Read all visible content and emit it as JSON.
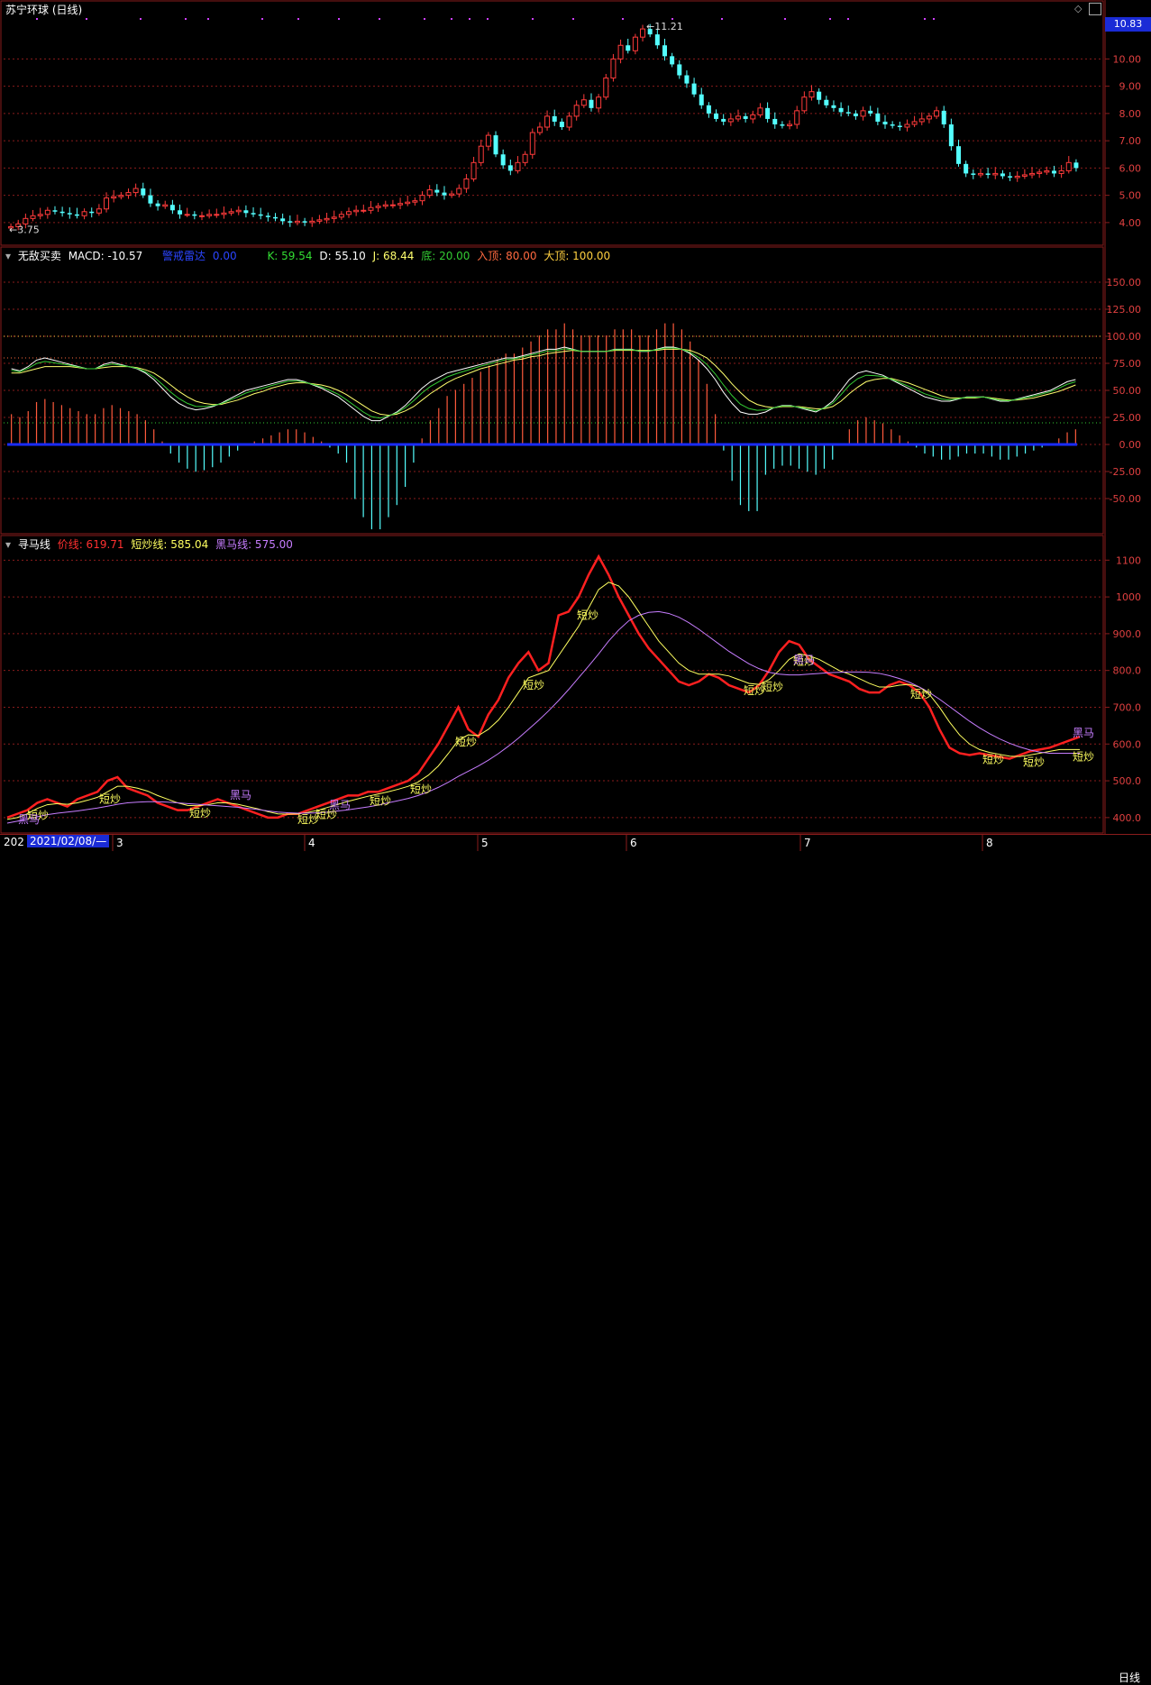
{
  "top_panel": {
    "title": "苏宁环球 (日线)",
    "high_label": "11.21",
    "low_label": "3.75",
    "current_price": "10.83",
    "y_ticks": [
      "10.00",
      "9.00",
      "8.00",
      "7.00",
      "6.00",
      "5.00",
      "4.00"
    ]
  },
  "mid_panel": {
    "indicator_name": "无敌买卖",
    "macd_label": "MACD: -10.57",
    "radar_label": "警戒雷达",
    "radar_value": "0.00",
    "k_label": "K: 59.54",
    "d_label": "D: 55.10",
    "j_label": "J: 68.44",
    "bottom_label": "底: 20.00",
    "entry_top_label": "入顶: 80.00",
    "big_top_label": "大顶: 100.00",
    "y_ticks": [
      "150.00",
      "125.00",
      "100.00",
      "75.00",
      "50.00",
      "25.00",
      "0.00",
      "-25.00",
      "-50.00"
    ]
  },
  "bottom_panel": {
    "indicator_name": "寻马线",
    "price_line_label": "价线: 619.71",
    "short_line_label": "短炒线: 585.04",
    "dark_horse_label": "黑马线: 575.00",
    "y_ticks": [
      "1100",
      "1000",
      "900.0",
      "800.0",
      "700.0",
      "600.0",
      "500.0",
      "400.0"
    ],
    "marker_short": "短炒",
    "marker_horse": "黑马"
  },
  "date_axis": {
    "start_stub": "202",
    "selected_date": "2021/02/08/—",
    "months": [
      "3",
      "4",
      "5",
      "6",
      "7",
      "8"
    ],
    "cycle": "日线"
  },
  "colors": {
    "up": "#ff3b3b",
    "down": "#54ffff",
    "macd_pos": "#ff5a3c",
    "macd_neg": "#54ffff",
    "k_line": "#ffffff",
    "d_line": "#ffff6e",
    "j_line": "#33cc33",
    "radar": "#1a2bff",
    "price_line": "#ff2020",
    "short_line": "#ffff60",
    "horse_line": "#c77dff",
    "grid": "#8a1c1c"
  },
  "chart_data": [
    {
      "type": "candlestick",
      "title": "苏宁环球 (日线)",
      "y_ticks": [
        4,
        5,
        6,
        7,
        8,
        9,
        10
      ],
      "ylim": [
        3.5,
        11.5
      ],
      "x_month_labels": [
        "3",
        "4",
        "5",
        "6",
        "7",
        "8"
      ],
      "annotated_high": 11.21,
      "annotated_low": 3.75,
      "last_price": 10.83,
      "closes": [
        3.85,
        3.95,
        4.15,
        4.25,
        4.3,
        4.45,
        4.4,
        4.35,
        4.3,
        4.25,
        4.4,
        4.35,
        4.5,
        4.9,
        4.95,
        5.0,
        5.1,
        5.25,
        5.0,
        4.7,
        4.6,
        4.65,
        4.45,
        4.3,
        4.3,
        4.25,
        4.25,
        4.3,
        4.3,
        4.35,
        4.4,
        4.45,
        4.35,
        4.3,
        4.25,
        4.2,
        4.15,
        4.05,
        4.0,
        4.05,
        4.0,
        4.05,
        4.1,
        4.15,
        4.2,
        4.3,
        4.4,
        4.45,
        4.45,
        4.55,
        4.6,
        4.65,
        4.65,
        4.7,
        4.75,
        4.8,
        5.0,
        5.2,
        5.1,
        5.0,
        5.05,
        5.25,
        5.6,
        6.2,
        6.8,
        7.2,
        6.5,
        6.1,
        5.9,
        6.2,
        6.5,
        7.3,
        7.5,
        7.9,
        7.7,
        7.5,
        7.9,
        8.3,
        8.5,
        8.2,
        8.6,
        9.3,
        10.0,
        10.5,
        10.3,
        10.8,
        11.1,
        10.9,
        10.5,
        10.1,
        9.8,
        9.4,
        9.1,
        8.7,
        8.3,
        8.0,
        7.8,
        7.7,
        7.8,
        7.9,
        7.8,
        7.95,
        8.2,
        7.8,
        7.6,
        7.55,
        7.6,
        8.1,
        8.6,
        8.8,
        8.5,
        8.3,
        8.2,
        8.05,
        8.0,
        7.9,
        8.1,
        8.0,
        7.7,
        7.6,
        7.55,
        7.5,
        7.6,
        7.7,
        7.8,
        7.9,
        8.1,
        7.6,
        6.8,
        6.15,
        5.8,
        5.75,
        5.8,
        5.75,
        5.8,
        5.7,
        5.65,
        5.7,
        5.75,
        5.8,
        5.85,
        5.9,
        5.8,
        5.9,
        6.2,
        6.0
      ]
    },
    {
      "type": "line",
      "title": "无敌买卖",
      "y_ticks": [
        -50,
        -25,
        0,
        25,
        50,
        75,
        100,
        125,
        150
      ],
      "ylim": [
        -75,
        175
      ],
      "reference_lines": {
        "bottom": 20.0,
        "entry_top": 80.0,
        "big_top": 100.0
      },
      "series": [
        {
          "name": "K",
          "last": 59.54
        },
        {
          "name": "D",
          "last": 55.1
        },
        {
          "name": "J",
          "last": 68.44
        },
        {
          "name": "MACD",
          "last": -10.57
        },
        {
          "name": "警戒雷达",
          "last": 0.0
        }
      ],
      "k_values": [
        70,
        68,
        72,
        78,
        80,
        78,
        76,
        74,
        72,
        70,
        70,
        74,
        76,
        74,
        72,
        70,
        66,
        60,
        52,
        44,
        38,
        34,
        32,
        33,
        35,
        38,
        42,
        46,
        50,
        52,
        54,
        56,
        58,
        60,
        60,
        58,
        55,
        52,
        48,
        44,
        38,
        32,
        26,
        22,
        22,
        26,
        30,
        36,
        44,
        52,
        58,
        62,
        66,
        68,
        70,
        72,
        74,
        76,
        78,
        80,
        80,
        82,
        84,
        86,
        88,
        88,
        90,
        88,
        86,
        86,
        86,
        86,
        88,
        88,
        88,
        86,
        86,
        88,
        90,
        90,
        88,
        84,
        78,
        70,
        60,
        48,
        38,
        30,
        28,
        28,
        30,
        34,
        36,
        36,
        34,
        32,
        30,
        34,
        40,
        50,
        60,
        66,
        68,
        66,
        64,
        60,
        56,
        52,
        48,
        44,
        42,
        40,
        40,
        42,
        44,
        44,
        44,
        42,
        40,
        40,
        42,
        44,
        46,
        48,
        50,
        54,
        58,
        60
      ],
      "d_values": [
        66,
        66,
        68,
        70,
        72,
        72,
        72,
        72,
        71,
        70,
        70,
        71,
        72,
        72,
        72,
        71,
        69,
        66,
        61,
        55,
        49,
        44,
        40,
        38,
        37,
        37,
        39,
        41,
        44,
        47,
        49,
        52,
        54,
        56,
        57,
        57,
        56,
        55,
        53,
        50,
        46,
        41,
        36,
        31,
        28,
        27,
        28,
        31,
        35,
        41,
        47,
        52,
        57,
        61,
        64,
        67,
        70,
        72,
        74,
        76,
        78,
        79,
        81,
        82,
        84,
        85,
        86,
        87,
        86,
        86,
        86,
        86,
        87,
        87,
        87,
        87,
        87,
        87,
        88,
        88,
        88,
        87,
        84,
        80,
        73,
        65,
        56,
        48,
        41,
        37,
        35,
        34,
        35,
        35,
        35,
        34,
        33,
        33,
        35,
        40,
        47,
        53,
        58,
        60,
        61,
        61,
        59,
        57,
        54,
        51,
        48,
        45,
        43,
        43,
        43,
        43,
        44,
        43,
        42,
        41,
        41,
        42,
        43,
        45,
        47,
        49,
        52,
        55
      ]
    },
    {
      "type": "line",
      "title": "寻马线",
      "y_ticks": [
        400,
        500,
        600,
        700,
        800,
        900,
        1000,
        1100
      ],
      "ylim": [
        380,
        1140
      ],
      "series": [
        {
          "name": "价线",
          "last": 619.71,
          "values": [
            400,
            410,
            420,
            440,
            450,
            440,
            430,
            450,
            460,
            470,
            500,
            510,
            480,
            470,
            460,
            440,
            430,
            420,
            420,
            430,
            440,
            450,
            440,
            430,
            420,
            410,
            400,
            400,
            410,
            410,
            420,
            430,
            440,
            450,
            460,
            460,
            470,
            470,
            480,
            490,
            500,
            520,
            560,
            600,
            650,
            700,
            640,
            620,
            680,
            720,
            780,
            820,
            850,
            800,
            820,
            950,
            960,
            1000,
            1060,
            1110,
            1060,
            1000,
            950,
            900,
            860,
            830,
            800,
            770,
            760,
            770,
            790,
            780,
            760,
            750,
            740,
            760,
            800,
            850,
            880,
            870,
            830,
            810,
            790,
            780,
            770,
            750,
            740,
            740,
            760,
            770,
            760,
            740,
            700,
            640,
            590,
            575,
            570,
            575,
            570,
            565,
            560,
            570,
            580,
            585,
            590,
            600,
            610,
            619.71
          ]
        },
        {
          "name": "短炒线",
          "last": 585.04,
          "values": [
            395,
            400,
            410,
            425,
            435,
            438,
            436,
            440,
            447,
            455,
            470,
            485,
            485,
            480,
            472,
            460,
            450,
            440,
            433,
            432,
            435,
            440,
            440,
            436,
            430,
            424,
            416,
            410,
            409,
            410,
            414,
            420,
            428,
            436,
            444,
            451,
            458,
            464,
            470,
            477,
            485,
            497,
            515,
            540,
            574,
            610,
            625,
            623,
            640,
            665,
            700,
            740,
            780,
            790,
            800,
            840,
            880,
            920,
            970,
            1020,
            1040,
            1030,
            1000,
            960,
            920,
            880,
            850,
            820,
            800,
            790,
            790,
            790,
            785,
            775,
            765,
            762,
            775,
            800,
            830,
            845,
            840,
            830,
            815,
            800,
            790,
            778,
            765,
            755,
            755,
            760,
            762,
            755,
            735,
            700,
            660,
            625,
            600,
            585,
            577,
            572,
            567,
            566,
            570,
            575,
            580,
            585.04,
            585.04,
            585.04
          ]
        },
        {
          "name": "黑马线",
          "last": 575.0,
          "values": [
            385,
            390,
            396,
            402,
            408,
            412,
            415,
            418,
            422,
            426,
            431,
            436,
            440,
            442,
            443,
            443,
            442,
            440,
            438,
            436,
            434,
            432,
            430,
            428,
            425,
            422,
            418,
            415,
            413,
            412,
            412,
            413,
            415,
            418,
            421,
            425,
            429,
            434,
            440,
            446,
            452,
            460,
            470,
            482,
            496,
            512,
            526,
            540,
            556,
            574,
            594,
            616,
            640,
            664,
            690,
            718,
            748,
            780,
            812,
            845,
            880,
            910,
            935,
            950,
            958,
            960,
            955,
            945,
            930,
            912,
            892,
            872,
            852,
            835,
            818,
            805,
            795,
            790,
            788,
            788,
            790,
            792,
            794,
            795,
            796,
            796,
            795,
            792,
            786,
            778,
            768,
            755,
            740,
            722,
            702,
            682,
            662,
            644,
            628,
            614,
            602,
            592,
            584,
            578,
            575,
            575,
            575,
            575
          ]
        }
      ],
      "markers": [
        "短炒",
        "黑马"
      ]
    }
  ]
}
